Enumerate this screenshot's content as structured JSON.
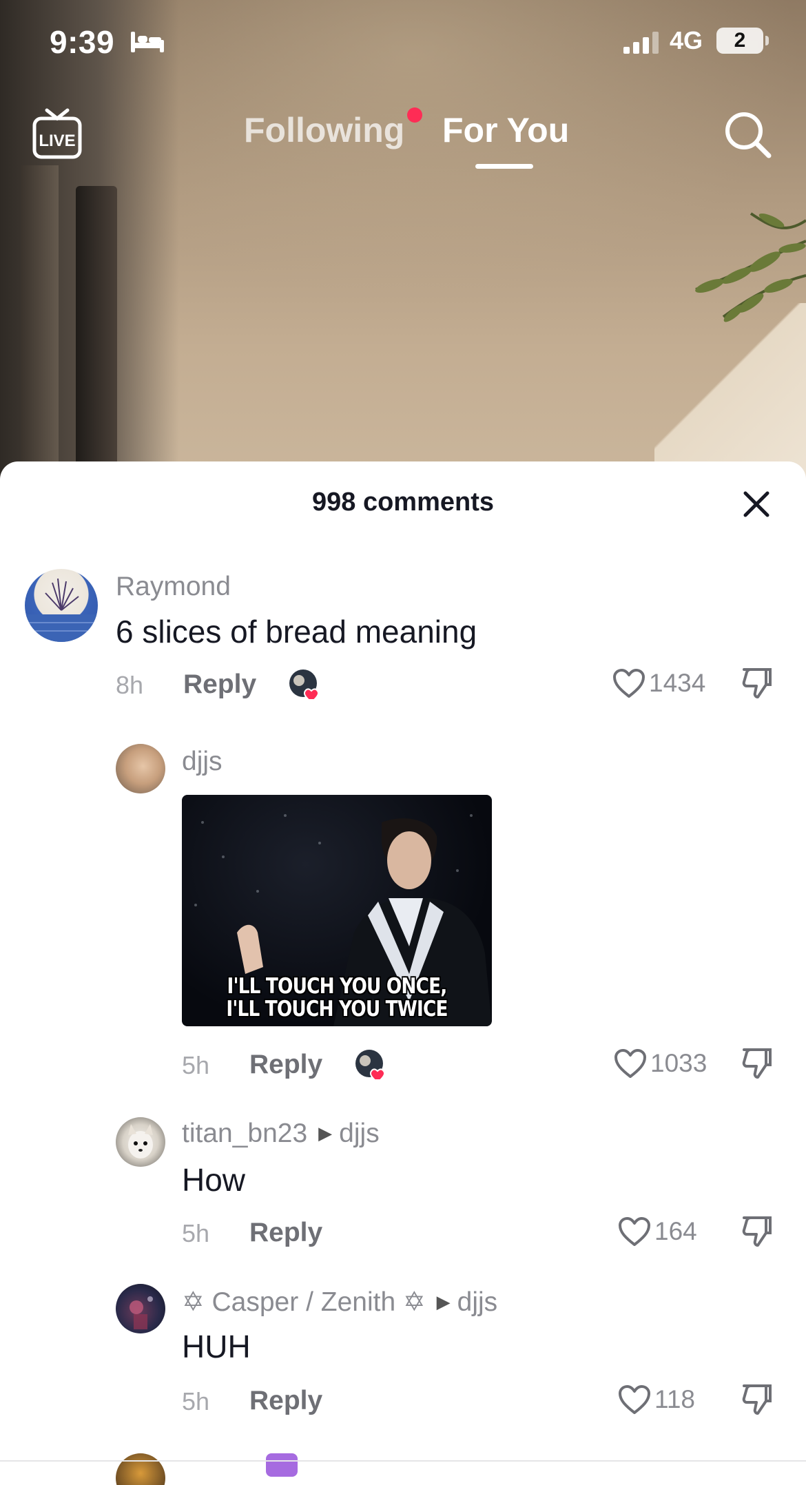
{
  "status_bar": {
    "time": "9:39",
    "network": "4G",
    "battery": "2"
  },
  "nav": {
    "live_label": "LIVE",
    "tabs": [
      {
        "label": "Following",
        "has_dot": true
      },
      {
        "label": "For You",
        "active": true
      }
    ]
  },
  "comments_panel": {
    "title": "998 comments",
    "comments": [
      {
        "username": "Raymond",
        "text": "6 slices of bread meaning",
        "time": "8h",
        "reply_label": "Reply",
        "likes": "1434",
        "creator_liked": true
      },
      {
        "username": "djjs",
        "gif_caption": "I'LL TOUCH YOU ONCE, I'LL TOUCH YOU TWICE",
        "gif_caption_line1": "I'LL TOUCH YOU ONCE,",
        "gif_caption_line2": "I'LL TOUCH YOU TWICE",
        "time": "5h",
        "reply_label": "Reply",
        "likes": "1033",
        "creator_liked": true
      },
      {
        "username": "titan_bn23",
        "reply_to": "djjs",
        "text": "How",
        "time": "5h",
        "reply_label": "Reply",
        "likes": "164"
      },
      {
        "username": "✡ Casper / Zenith ✡",
        "reply_to": "djjs",
        "text": "HUH",
        "time": "5h",
        "reply_label": "Reply",
        "likes": "118"
      }
    ]
  },
  "colors": {
    "accent": "#fe2c55",
    "text_primary": "#161823",
    "text_secondary": "#8a8b91"
  },
  "icons": [
    "bed-icon",
    "signal-icon",
    "live-icon",
    "search-icon",
    "close-icon",
    "heart-icon",
    "dislike-icon"
  ]
}
